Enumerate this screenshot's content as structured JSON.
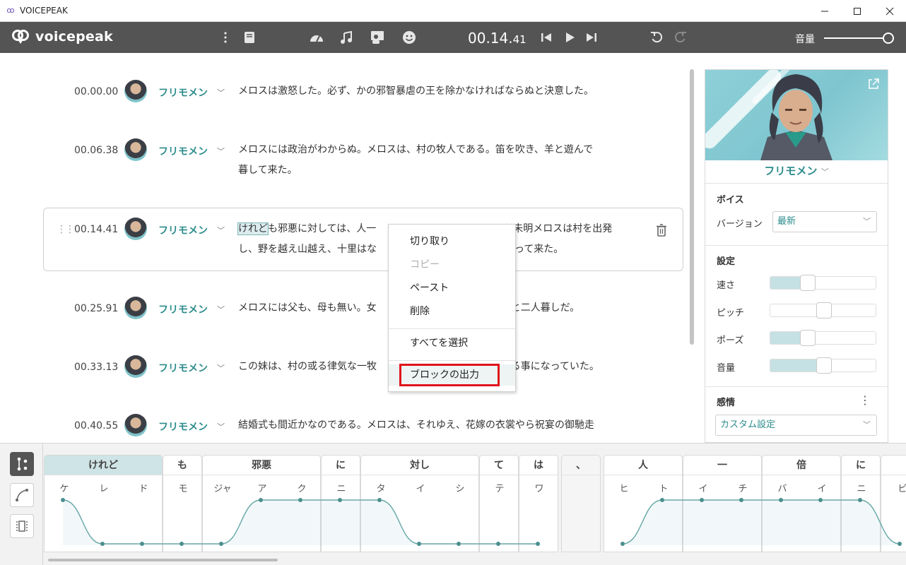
{
  "window": {
    "title": "VOICEPEAK"
  },
  "toolbar": {
    "logo_text": "voicepeak",
    "timecode_main": "00.14.",
    "timecode_frac": "41",
    "volume_label": "音量"
  },
  "rows": [
    {
      "time": "00.00.00",
      "speaker": "フリモメン",
      "text": "メロスは激怒した。必ず、かの邪智暴虐の王を除かなければならぬと決意した。"
    },
    {
      "time": "00.06.38",
      "speaker": "フリモメン",
      "text_l1": "メロスには政治がわからぬ。メロスは、村の牧人である。笛を吹き、羊と遊んで",
      "text_l2": "暮して来た。"
    },
    {
      "time": "00.14.41",
      "speaker": "フリモメン",
      "sel": "けれど",
      "text_l1a": "も邪悪に対しては、人一",
      "text_l1b": "う未明メロスは村を出発",
      "text_l2a": "し、野を越え山越え、十里はな",
      "text_l2b": "やって来た。"
    },
    {
      "time": "00.25.91",
      "speaker": "フリモメン",
      "text_a": "メロスには父も、母も無い。女",
      "text_b": "な妹と二人暮しだ。"
    },
    {
      "time": "00.33.13",
      "speaker": "フリモメン",
      "text_a": "この妹は、村の或る律気な一牧",
      "text_b": "迎える事になっていた。"
    },
    {
      "time": "00.40.55",
      "speaker": "フリモメン",
      "text": "結婚式も間近かなのである。メロスは、それゆえ、花嫁の衣裳やら祝宴の御馳走"
    }
  ],
  "context_menu": {
    "cut": "切り取り",
    "copy": "コピー",
    "paste": "ペースト",
    "delete": "削除",
    "select_all": "すべてを選択",
    "export_block": "ブロックの出力"
  },
  "panel": {
    "name": "フリモメン",
    "voice_heading": "ボイス",
    "version_label": "バージョン",
    "version_value": "最新",
    "settings_heading": "設定",
    "emotion_heading": "感情",
    "emotion_value": "カスタム設定",
    "sliders": [
      {
        "label": "速さ",
        "value": 0.35
      },
      {
        "label": "ピッチ",
        "value": 0.5
      },
      {
        "label": "ポーズ",
        "value": 0.35
      },
      {
        "label": "音量",
        "value": 0.5
      }
    ]
  },
  "editor": {
    "words": [
      {
        "label": "けれど",
        "moras": [
          "ケ",
          "レ",
          "ド"
        ]
      },
      {
        "label": "も",
        "moras": [
          "モ"
        ]
      },
      {
        "label": "邪悪",
        "moras": [
          "ジャ",
          "ア",
          "ク"
        ]
      },
      {
        "label": "に",
        "moras": [
          "ニ"
        ]
      },
      {
        "label": "対し",
        "moras": [
          "タ",
          "イ",
          "シ"
        ]
      },
      {
        "label": "て",
        "moras": [
          "テ"
        ]
      },
      {
        "label": "は",
        "moras": [
          "ワ"
        ]
      },
      {
        "label": "、",
        "moras": []
      },
      {
        "label": "人",
        "moras": [
          "ヒ",
          "ト"
        ]
      },
      {
        "label": "一",
        "moras": [
          "イ",
          "チ"
        ]
      },
      {
        "label": "倍",
        "moras": [
          "バ",
          "イ"
        ]
      },
      {
        "label": "に",
        "moras": [
          "ニ"
        ]
      },
      {
        "label": "",
        "moras": [
          "ビ"
        ]
      }
    ]
  },
  "colors": {
    "accent": "#2d8c8c",
    "toolbar": "#545454",
    "highlight_box": "#e0141c"
  }
}
